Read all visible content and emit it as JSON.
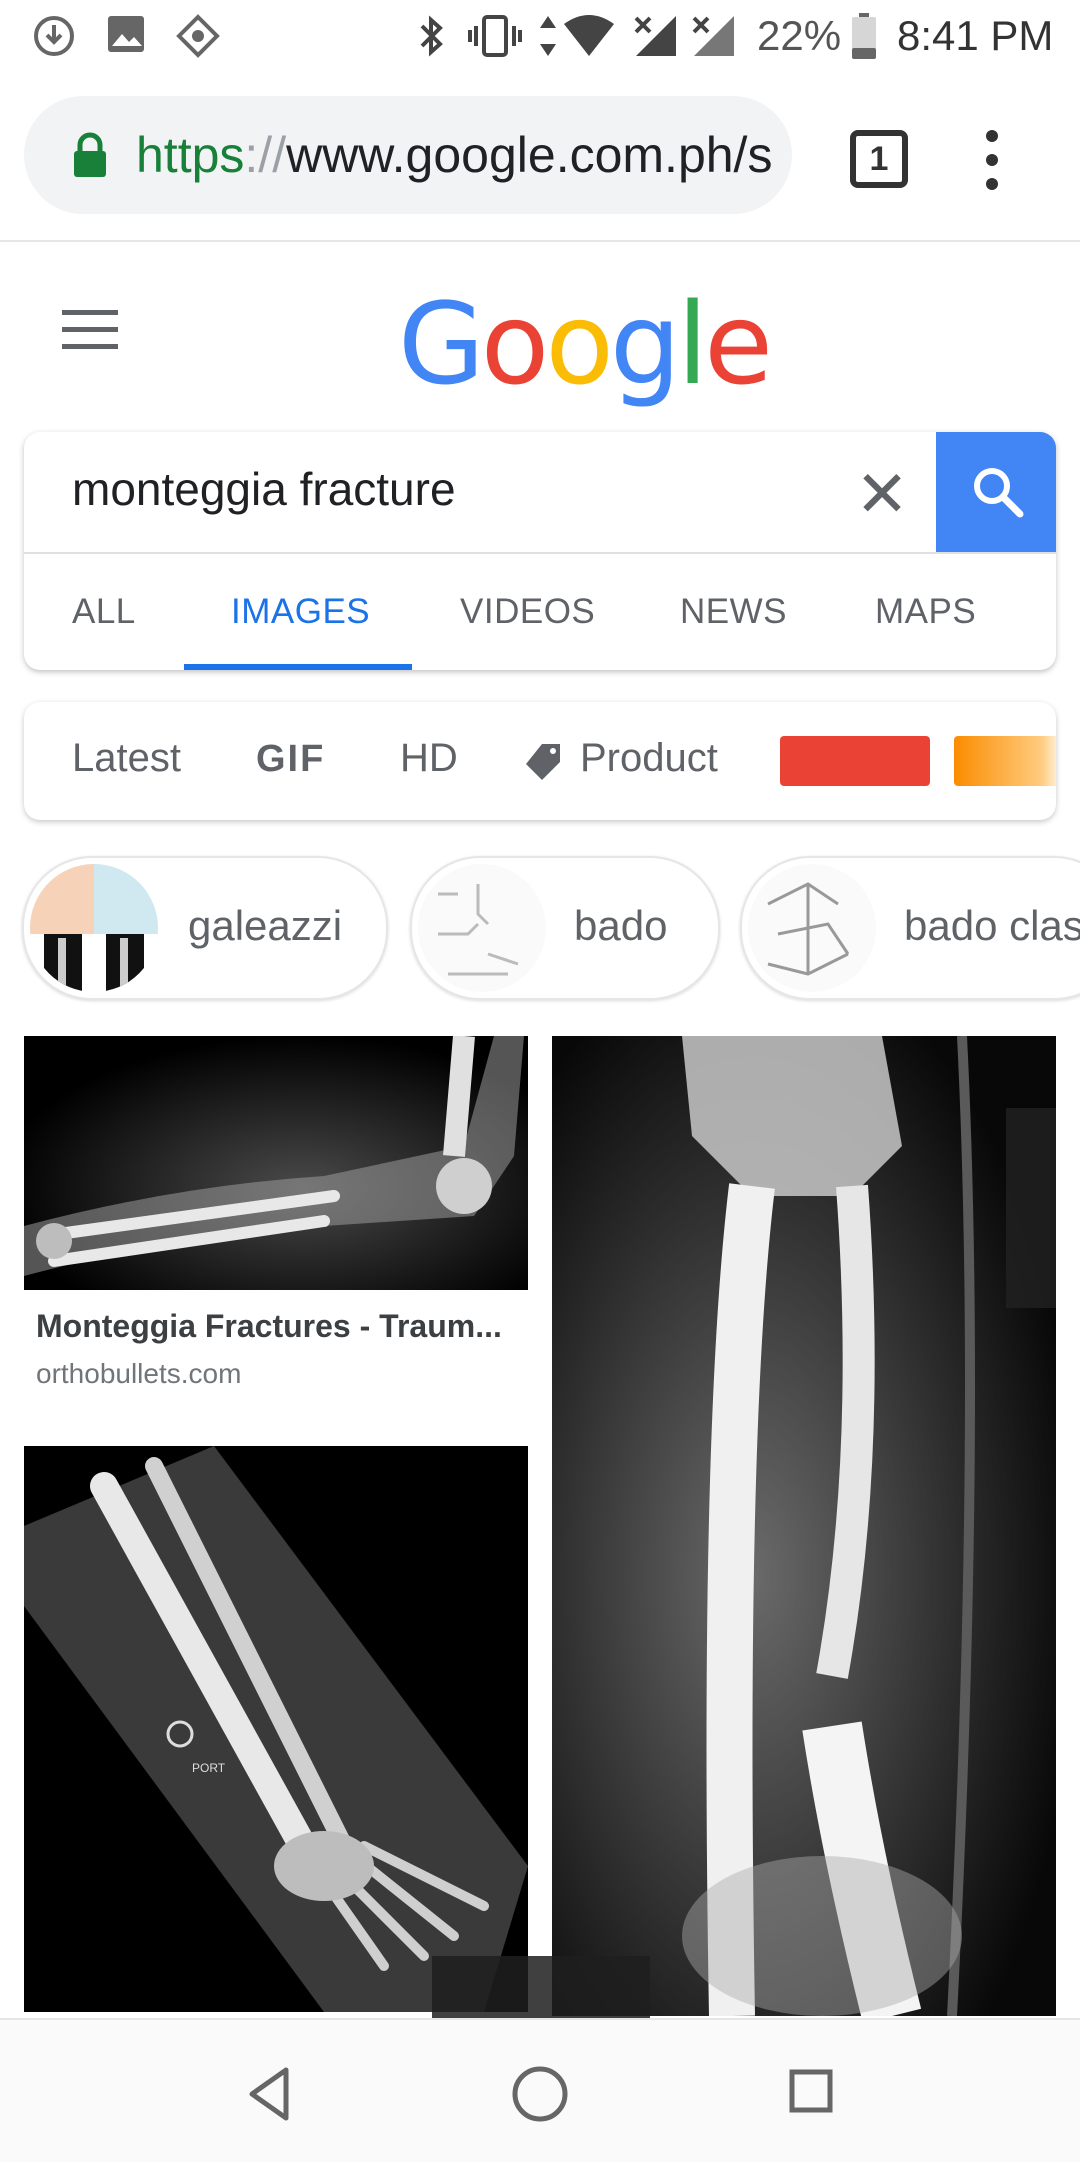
{
  "status_bar": {
    "battery": "22%",
    "time": "8:41 PM",
    "icons": [
      "download-icon",
      "image-icon",
      "app-icon",
      "bluetooth-icon",
      "vibrate-icon",
      "data-arrows-icon",
      "wifi-icon",
      "signal-icon",
      "signal-icon-2",
      "battery-icon"
    ]
  },
  "browser": {
    "url_scheme": "https",
    "url_sep": "://",
    "url_rest": "www.google.com.ph/s",
    "tab_count": "1"
  },
  "google": {
    "logo_letters": [
      {
        "ch": "G",
        "color": "#4285f4"
      },
      {
        "ch": "o",
        "color": "#ea4335"
      },
      {
        "ch": "o",
        "color": "#fbbc05"
      },
      {
        "ch": "g",
        "color": "#4285f4"
      },
      {
        "ch": "l",
        "color": "#34a853"
      },
      {
        "ch": "e",
        "color": "#ea4335"
      }
    ]
  },
  "search": {
    "query": "monteggia fracture",
    "tabs": [
      "ALL",
      "IMAGES",
      "VIDEOS",
      "NEWS",
      "MAPS"
    ],
    "active_tab": "IMAGES"
  },
  "filters": {
    "latest": "Latest",
    "gif": "GIF",
    "hd": "HD",
    "product": "Product",
    "color_swatches": [
      "#ea4335",
      "#fb8c00"
    ]
  },
  "related": [
    {
      "label": "galeazzi"
    },
    {
      "label": "bado"
    },
    {
      "label": "bado clas"
    }
  ],
  "results": [
    {
      "title": "Monteggia Fractures - Traum...",
      "source": "orthobullets.com"
    }
  ],
  "colors": {
    "accent": "#1a73e8",
    "search_button": "#4285f4"
  }
}
